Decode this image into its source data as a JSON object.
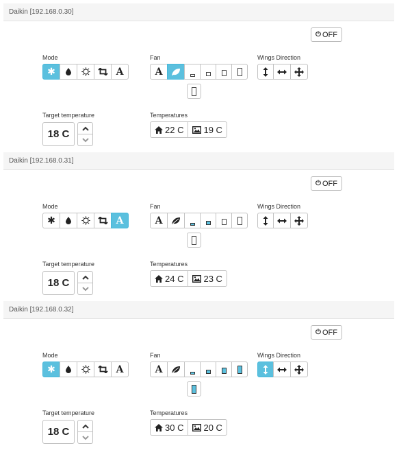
{
  "labels": {
    "mode": "Mode",
    "fan": "Fan",
    "wings": "Wings Direction",
    "target": "Target temperature",
    "temperatures": "Temperatures",
    "off": "OFF"
  },
  "icons": {
    "power": "power-icon",
    "cool": "snowflake-icon",
    "dry": "droplet-icon",
    "heat": "sun-icon",
    "fan_only": "retweet-icon",
    "auto": "letter-a-icon",
    "fan_auto": "letter-a-icon",
    "fan_silence": "leaf-icon",
    "wings_vertical": "arrows-vertical-icon",
    "wings_horizontal": "arrows-horizontal-icon",
    "wings_both": "arrows-move-icon",
    "indoor": "home-icon",
    "outdoor": "picture-icon"
  },
  "accent_color": "#5bc0de",
  "devices": [
    {
      "name": "Daikin [192.168.0.30]",
      "mode_active": "cool",
      "fan_active": "silence",
      "fan_level": 0,
      "wings_active": "none",
      "target_temp": "18 C",
      "indoor_temp": "22 C",
      "outdoor_temp": "19 C"
    },
    {
      "name": "Daikin [192.168.0.31]",
      "mode_active": "auto",
      "fan_active": "level",
      "fan_level": 2,
      "wings_active": "none",
      "target_temp": "18 C",
      "indoor_temp": "24 C",
      "outdoor_temp": "23 C"
    },
    {
      "name": "Daikin [192.168.0.32]",
      "mode_active": "cool",
      "fan_active": "level",
      "fan_level": 5,
      "wings_active": "vertical",
      "target_temp": "18 C",
      "indoor_temp": "30 C",
      "outdoor_temp": "20 C"
    }
  ]
}
